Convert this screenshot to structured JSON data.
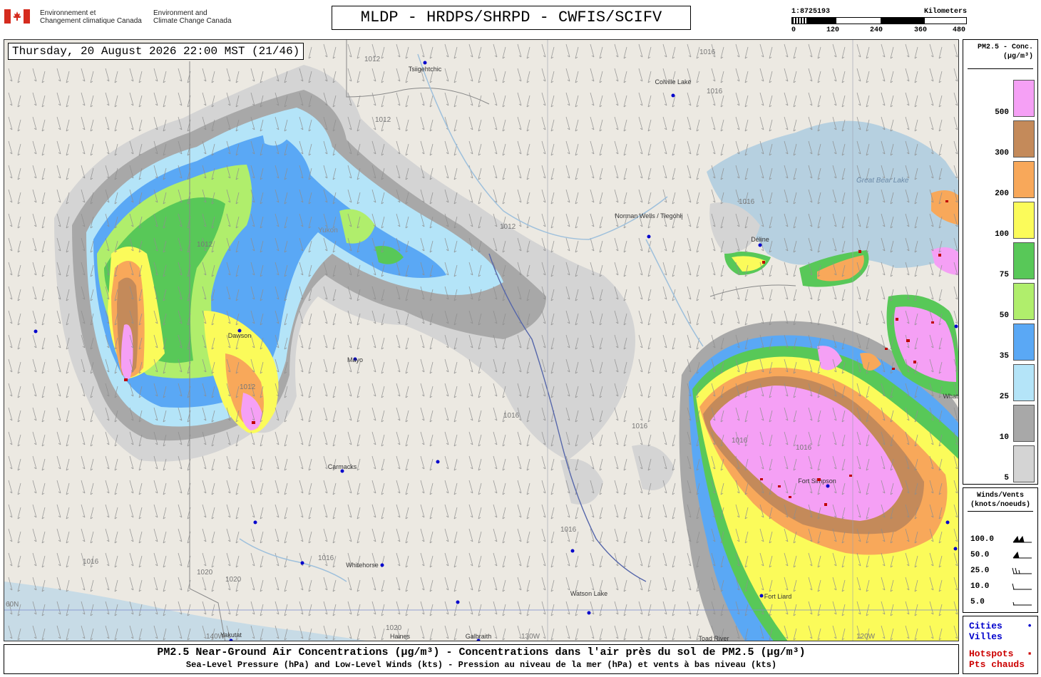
{
  "header": {
    "logo": "canada-flag-icon",
    "agency_fr_line1": "Environnement et",
    "agency_fr_line2": "Changement climatique Canada",
    "agency_en_line1": "Environment and",
    "agency_en_line2": "Climate Change Canada",
    "title": "MLDP - HRDPS/SHRPD - CWFIS/SCIFV"
  },
  "scalebar": {
    "ratio": "1:8725193",
    "unit": "Kilometers",
    "ticks": [
      "0",
      "120",
      "240",
      "360",
      "480"
    ]
  },
  "map": {
    "timestamp": "Thursday, 20 August 2026 22:00 MST (21/46)",
    "cities": [
      {
        "name": "Tsiigehtchic"
      },
      {
        "name": "Colville Lake"
      },
      {
        "name": "Norman Wells / Tłegóhłį"
      },
      {
        "name": "Déline"
      },
      {
        "name": "Dawson"
      },
      {
        "name": "Mayo"
      },
      {
        "name": "Carmacks"
      },
      {
        "name": "Whitehorse"
      },
      {
        "name": "Watson Lake"
      },
      {
        "name": "Fort Liard"
      },
      {
        "name": "Fort Simpson"
      },
      {
        "name": "Yakutat"
      },
      {
        "name": "Haines"
      },
      {
        "name": "Galbraith"
      },
      {
        "name": "Toad River"
      },
      {
        "name": "Whati"
      }
    ],
    "features": {
      "lake": "Great Bear Lake",
      "territory": "Yukon",
      "lon_labels": [
        "130W",
        "120W",
        "140W"
      ],
      "lat_label": "60N"
    },
    "isobar_labels": [
      "1012",
      "1016",
      "1020"
    ]
  },
  "pm_legend": {
    "title": "PM2.5 - Conc.\n(µg/m³)",
    "levels": [
      {
        "label": "500",
        "color": "#f5a0f5"
      },
      {
        "label": "300",
        "color": "#c48a5a"
      },
      {
        "label": "200",
        "color": "#f8a85a"
      },
      {
        "label": "100",
        "color": "#fbfb5a"
      },
      {
        "label": "75",
        "color": "#58c858"
      },
      {
        "label": "50",
        "color": "#b0ee6c"
      },
      {
        "label": "35",
        "color": "#5aa8f5"
      },
      {
        "label": "25",
        "color": "#b4e4f8"
      },
      {
        "label": "10",
        "color": "#a8a8a8"
      },
      {
        "label": "5",
        "color": "#d4d4d4"
      }
    ]
  },
  "wind_legend": {
    "title": "Winds/Vents\n(knots/noeuds)",
    "rows": [
      "100.0",
      "50.0",
      "25.0",
      "10.0",
      "5.0"
    ]
  },
  "point_legend": {
    "cities_en": "Cities",
    "cities_fr": "Villes",
    "hotspots_en": "Hotspots",
    "hotspots_fr": "Pts chauds",
    "city_color": "#0000cc",
    "hotspot_color": "#cc0000"
  },
  "caption": {
    "line1": "PM2.5 Near-Ground Air Concentrations (µg/m³) - Concentrations dans l'air près du sol de PM2.5 (µg/m³)",
    "line2": "Sea-Level Pressure (hPa) and Low-Level Winds (kts) - Pression au niveau de la mer (hPa) et vents à bas niveau (kts)"
  }
}
